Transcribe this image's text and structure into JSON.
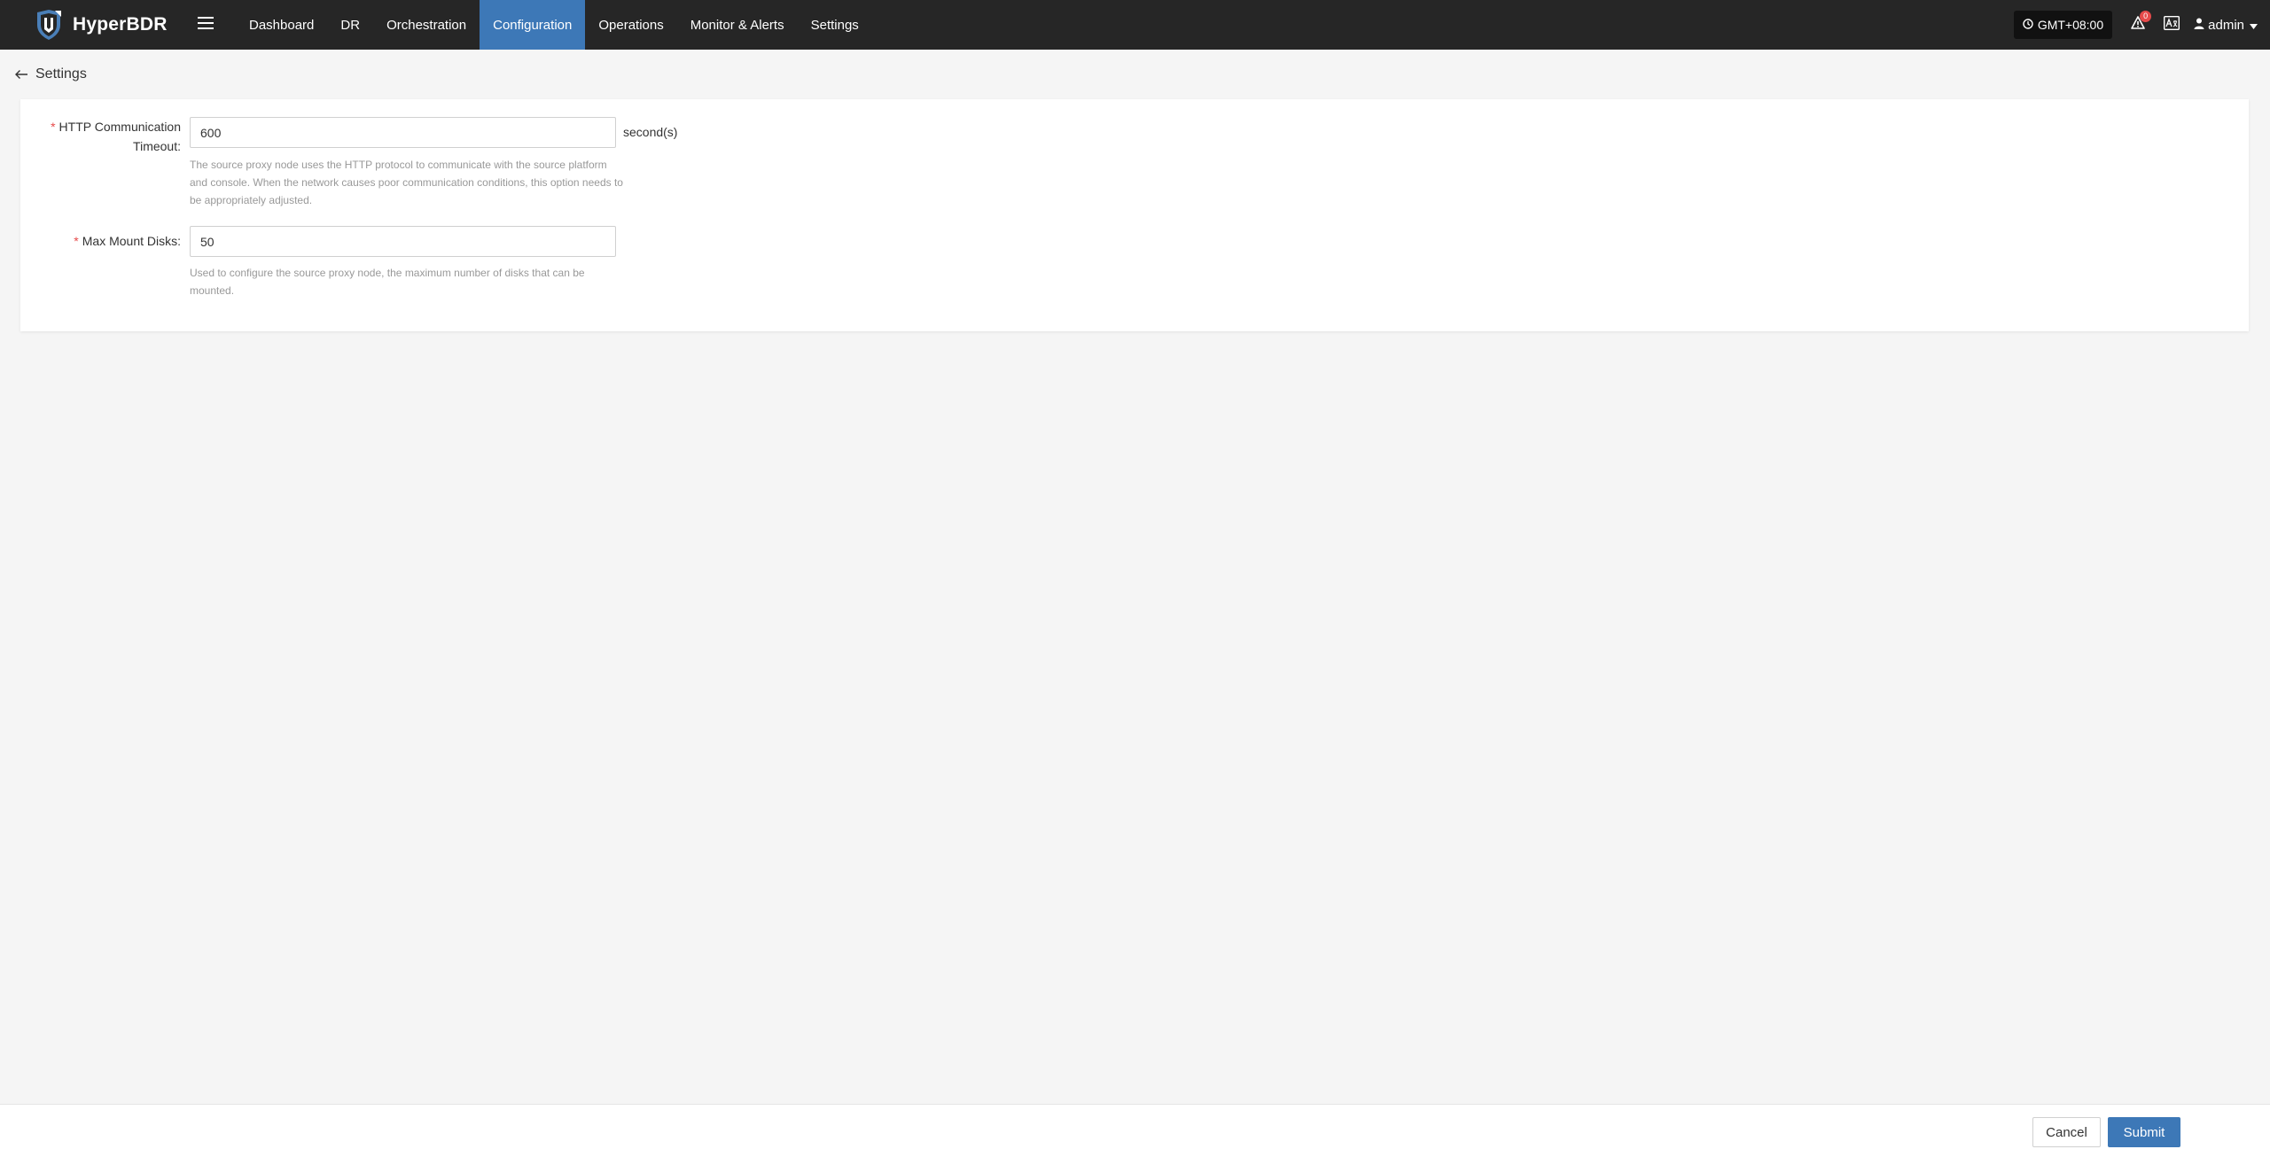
{
  "app": {
    "name": "HyperBDR"
  },
  "nav": {
    "items": [
      {
        "label": "Dashboard",
        "active": false
      },
      {
        "label": "DR",
        "active": false
      },
      {
        "label": "Orchestration",
        "active": false
      },
      {
        "label": "Configuration",
        "active": true
      },
      {
        "label": "Operations",
        "active": false
      },
      {
        "label": "Monitor & Alerts",
        "active": false
      },
      {
        "label": "Settings",
        "active": false
      }
    ]
  },
  "header_right": {
    "timezone": "GMT+08:00",
    "alert_count": "0",
    "user": "admin"
  },
  "page": {
    "title": "Settings"
  },
  "form": {
    "http_timeout": {
      "label": "HTTP Communication Timeout:",
      "value": "600",
      "suffix": "second(s)",
      "help": "The source proxy node uses the HTTP protocol to communicate with the source platform and console. When the network causes poor communication conditions, this option needs to be appropriately adjusted."
    },
    "max_mount_disks": {
      "label": "Max Mount Disks:",
      "value": "50",
      "help": "Used to configure the source proxy node, the maximum number of disks that can be mounted."
    }
  },
  "footer": {
    "cancel_label": "Cancel",
    "submit_label": "Submit"
  },
  "colors": {
    "accent": "#3d78b7",
    "topbar": "#262626",
    "required": "#e64a4a"
  },
  "icons": {
    "logo": "shield-logo-icon",
    "menu": "hamburger-icon",
    "timezone": "clock-icon",
    "alerts": "bell-icon",
    "language": "translate-icon",
    "user": "user-icon",
    "back": "arrow-left-icon"
  }
}
